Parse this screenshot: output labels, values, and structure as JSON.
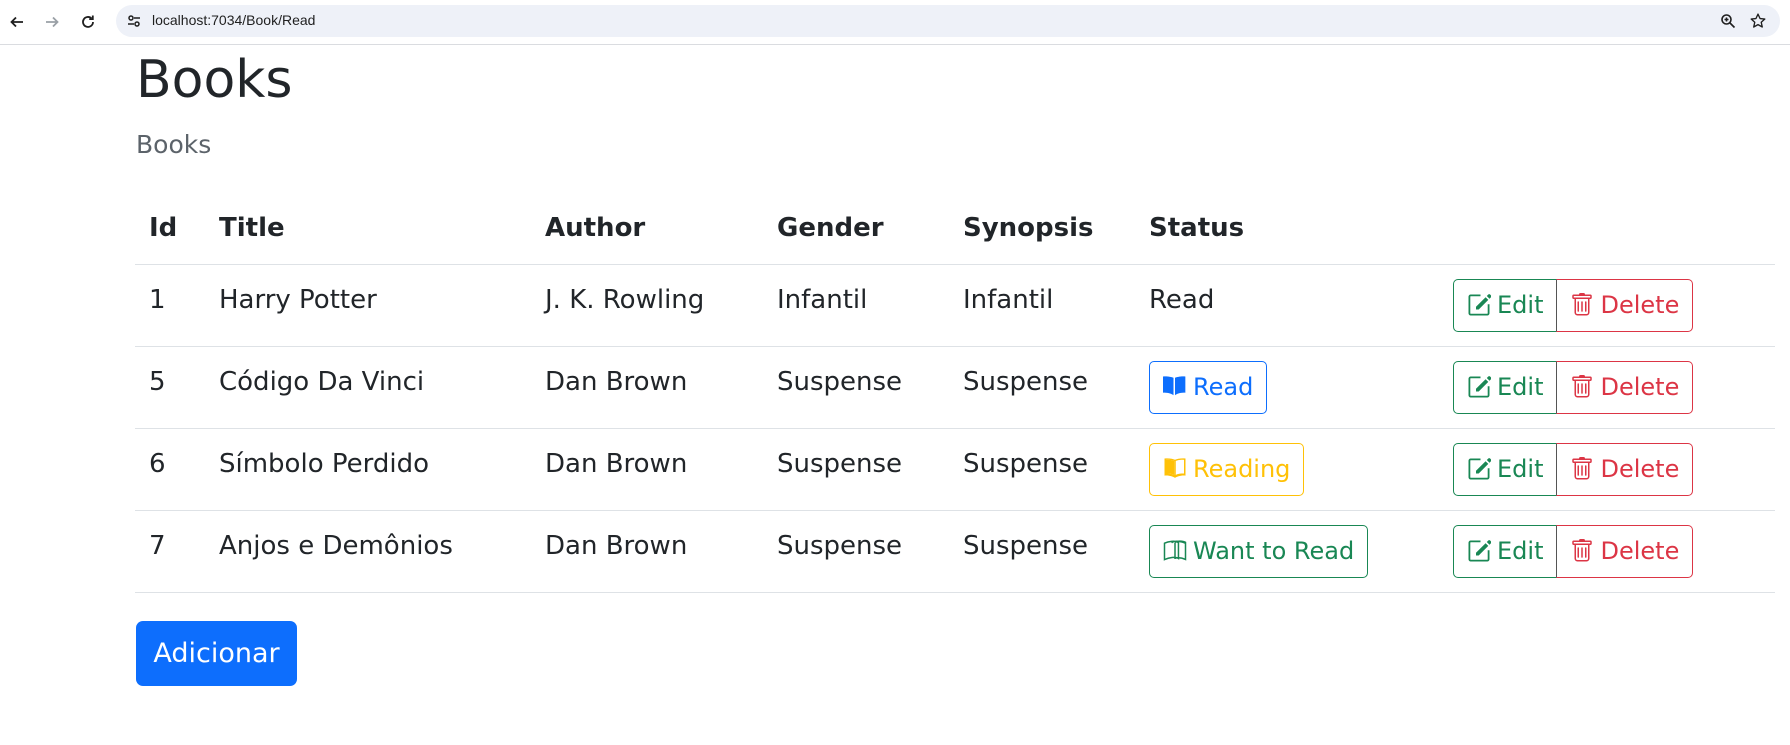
{
  "browser": {
    "url": "localhost:7034/Book/Read"
  },
  "page": {
    "title": "Books",
    "subtitle": "Books"
  },
  "table": {
    "headers": [
      "Id",
      "Title",
      "Author",
      "Gender",
      "Synopsis",
      "Status",
      ""
    ],
    "rows": [
      {
        "id": "1",
        "title": "Harry Potter",
        "author": "J. K. Rowling",
        "gender": "Infantil",
        "synopsis": "Infantil",
        "status": "Read",
        "status_style": "plain",
        "edit_label": "Edit",
        "delete_label": "Delete"
      },
      {
        "id": "5",
        "title": "Código Da Vinci",
        "author": "Dan Brown",
        "gender": "Suspense",
        "synopsis": "Suspense",
        "status": "Read",
        "status_style": "button-blue",
        "edit_label": "Edit",
        "delete_label": "Delete"
      },
      {
        "id": "6",
        "title": "Símbolo Perdido",
        "author": "Dan Brown",
        "gender": "Suspense",
        "synopsis": "Suspense",
        "status": "Reading",
        "status_style": "button-yellow",
        "edit_label": "Edit",
        "delete_label": "Delete"
      },
      {
        "id": "7",
        "title": "Anjos e Demônios",
        "author": "Dan Brown",
        "gender": "Suspense",
        "synopsis": "Suspense",
        "status": "Want to Read",
        "status_style": "button-green",
        "edit_label": "Edit",
        "delete_label": "Delete"
      }
    ]
  },
  "add_button": {
    "label": "Adicionar"
  },
  "colors": {
    "primary": "#0d6efd",
    "warning": "#ffc107",
    "success": "#198754",
    "danger": "#dc3545"
  },
  "icons": {
    "back": "arrow-left-icon",
    "forward": "arrow-right-icon",
    "reload": "reload-icon",
    "site_info": "tune-icon",
    "zoom": "zoom-icon",
    "bookmark": "star-icon",
    "read": "book-filled-icon",
    "reading": "book-half-icon",
    "want_to_read": "book-outline-icon",
    "edit": "pencil-square-icon",
    "delete": "trash-icon"
  }
}
